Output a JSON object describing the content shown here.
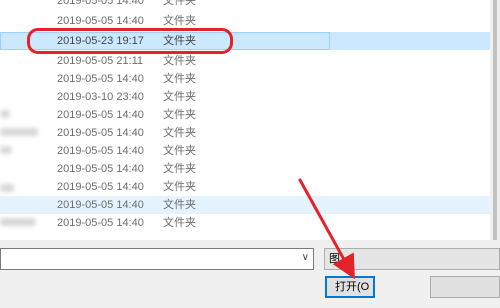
{
  "file_list": {
    "rows": [
      {
        "date": "2019-05-05 14:40",
        "type": "文件夹"
      },
      {
        "date": "2019-05-05 14:40",
        "type": "文件夹"
      },
      {
        "date": "2019-05-23 19:17",
        "type": "文件夹",
        "selected": true
      },
      {
        "date": "2019-05-05 21:11",
        "type": "文件夹"
      },
      {
        "date": "2019-05-05 14:40",
        "type": "文件夹"
      },
      {
        "date": "2019-03-10 23:40",
        "type": "文件夹"
      },
      {
        "date": "2019-05-05 14:40",
        "type": "文件夹"
      },
      {
        "date": "2019-05-05 14:40",
        "type": "文件夹"
      },
      {
        "date": "2019-05-05 14:40",
        "type": "文件夹"
      },
      {
        "date": "2019-05-05 14:40",
        "type": "文件夹"
      },
      {
        "date": "2019-05-05 14:40",
        "type": "文件夹"
      },
      {
        "date": "2019-05-05 14:40",
        "type": "文件夹"
      },
      {
        "date": "2019-05-05 14:40",
        "type": "文件夹"
      }
    ]
  },
  "dialog": {
    "filter_label": "图",
    "open_label": "打开(O"
  },
  "annotation": {
    "color": "#e3232a"
  }
}
